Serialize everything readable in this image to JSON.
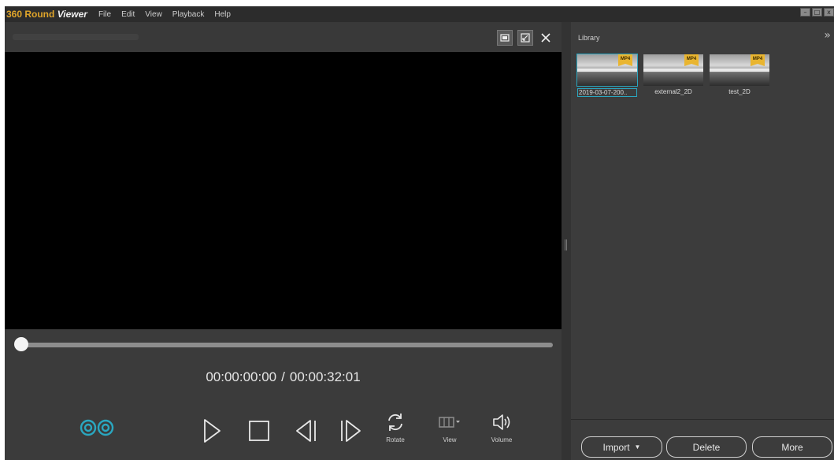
{
  "app": {
    "title_part1": "360 Round",
    "title_part2": "Viewer",
    "menu": [
      "File",
      "Edit",
      "View",
      "Playback",
      "Help"
    ]
  },
  "player": {
    "current_time": "00:00:00:00",
    "separator": "/",
    "total_time": "00:00:32:01",
    "progress": 0,
    "controls": {
      "rotate_label": "Rotate",
      "view_label": "View",
      "volume_label": "Volume"
    }
  },
  "library": {
    "title": "Library",
    "items": [
      {
        "name": "2019-03-07-200..",
        "badge": "MP4",
        "selected": true
      },
      {
        "name": "external2_2D",
        "badge": "MP4",
        "selected": false
      },
      {
        "name": "test_2D",
        "badge": "MP4",
        "selected": false
      }
    ],
    "buttons": {
      "import_label": "Import",
      "delete_label": "Delete",
      "more_label": "More"
    }
  },
  "colors": {
    "accent": "#2aa7c0",
    "brand": "#e0a52a",
    "badge": "#e9b530"
  }
}
